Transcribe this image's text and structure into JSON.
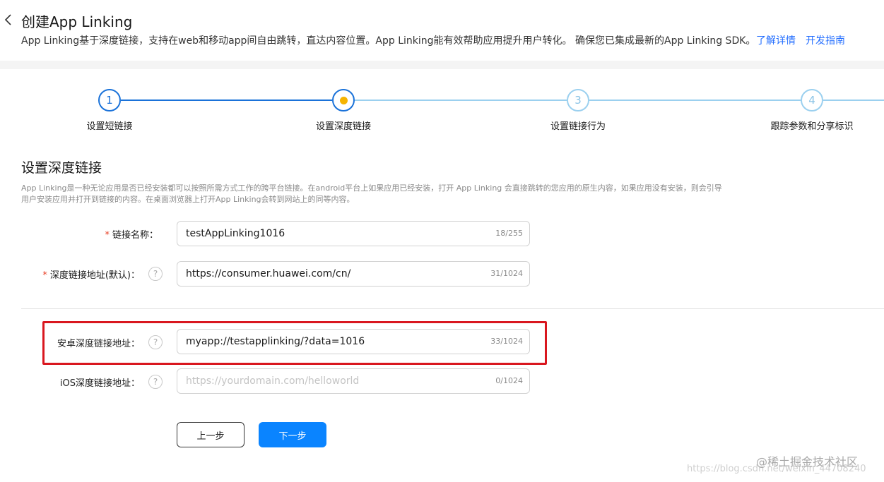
{
  "header": {
    "back_icon": "chevron-left-icon",
    "title": "创建App Linking",
    "description": "App Linking基于深度链接，支持在web和移动app间自由跳转，直达内容位置。App Linking能有效帮助应用提升用户转化。 确保您已集成最新的App Linking SDK。",
    "link_learn_more": "了解详情",
    "link_dev_guide": "开发指南"
  },
  "steps": [
    {
      "number": "1",
      "label": "设置短链接",
      "state": "done"
    },
    {
      "number": "",
      "label": "设置深度链接",
      "state": "active"
    },
    {
      "number": "3",
      "label": "设置链接行为",
      "state": "todo"
    },
    {
      "number": "4",
      "label": "跟踪参数和分享标识",
      "state": "todo"
    }
  ],
  "section": {
    "title": "设置深度链接",
    "description": "App Linking是一种无论应用是否已经安装都可以按照所需方式工作的跨平台链接。在android平台上如果应用已经安装，打开 App Linking 会直接跳转的您应用的原生内容，如果应用没有安装，则会引导用户安装应用并打开到链接的内容。在桌面浏览器上打开App Linking会转到网站上的同等内容。"
  },
  "fields": {
    "link_name": {
      "required_mark": "*",
      "label": "链接名称：",
      "value": "testAppLinking1016",
      "placeholder": "",
      "counter": "18/255"
    },
    "deep_link_default": {
      "required_mark": "*",
      "label": "深度链接地址(默认)：",
      "value": "https://consumer.huawei.com/cn/",
      "placeholder": "",
      "counter": "31/1024",
      "help_icon": "question-circle-icon"
    },
    "android_deep_link": {
      "label": "安卓深度链接地址：",
      "value": "myapp://testapplinking/?data=1016",
      "placeholder": "",
      "counter": "33/1024",
      "help_icon": "question-circle-icon"
    },
    "ios_deep_link": {
      "label": "iOS深度链接地址：",
      "value": "",
      "placeholder": "https://yourdomain.com/helloworld",
      "counter": "0/1024",
      "help_icon": "question-circle-icon"
    }
  },
  "help_glyph": "?",
  "buttons": {
    "prev": "上一步",
    "next": "下一步"
  },
  "watermark": {
    "brand": "@稀土掘金技术社区",
    "url": "https://blog.csdn.net/weixin_44708240"
  },
  "colors": {
    "accent": "#0a84ff",
    "link": "#256fff",
    "step_done": "#1a72d9",
    "step_active_dot": "#f6b400",
    "step_todo": "#9bd0ef",
    "highlight_border": "#d9171f",
    "required": "#e84026"
  }
}
